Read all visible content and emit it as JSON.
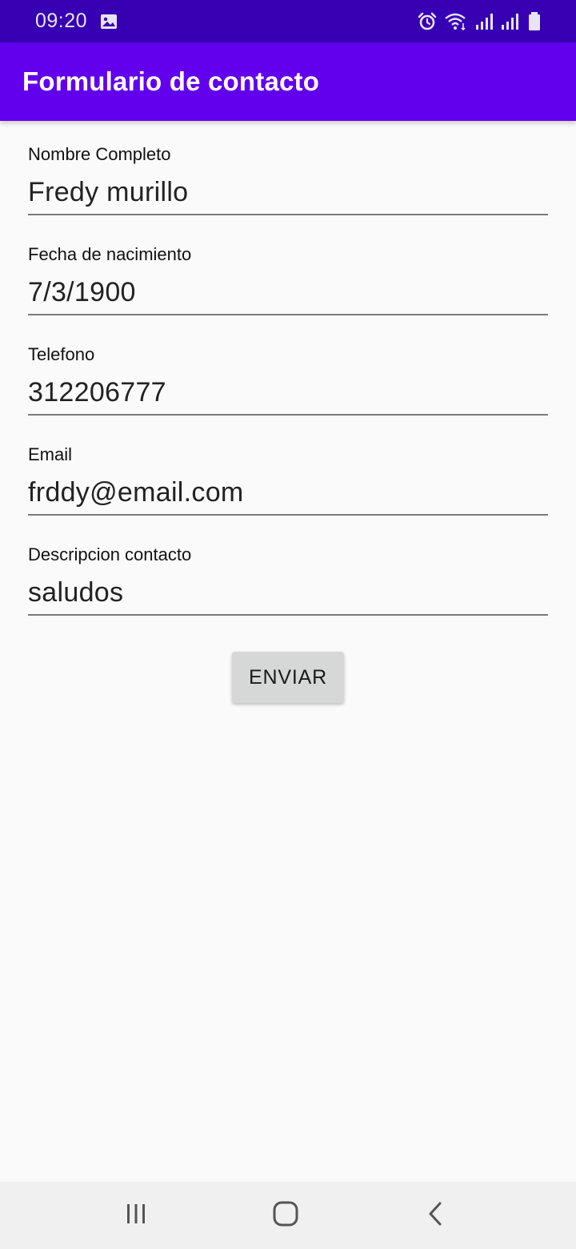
{
  "status_bar": {
    "time": "09:20",
    "left_icons": [
      "image-icon"
    ],
    "right_icons": [
      "alarm-icon",
      "wifi-icon",
      "signal-icon",
      "signal-icon",
      "battery-icon"
    ]
  },
  "app_bar": {
    "title": "Formulario de contacto"
  },
  "form": {
    "fields": [
      {
        "label": "Nombre Completo",
        "value": "Fredy murillo"
      },
      {
        "label": "Fecha de nacimiento",
        "value": "7/3/1900"
      },
      {
        "label": "Telefono",
        "value": "312206777"
      },
      {
        "label": "Email",
        "value": "frddy@email.com"
      },
      {
        "label": "Descripcion contacto",
        "value": "saludos"
      }
    ],
    "submit_label": "ENVIAR"
  },
  "nav_bar": {
    "icons": [
      "recents-icon",
      "home-icon",
      "back-icon"
    ]
  },
  "colors": {
    "status_bar": "#3700b3",
    "app_bar": "#6200ee",
    "background": "#fafafa",
    "button": "#d6d7d7",
    "nav_bar": "#f0f0f0"
  }
}
